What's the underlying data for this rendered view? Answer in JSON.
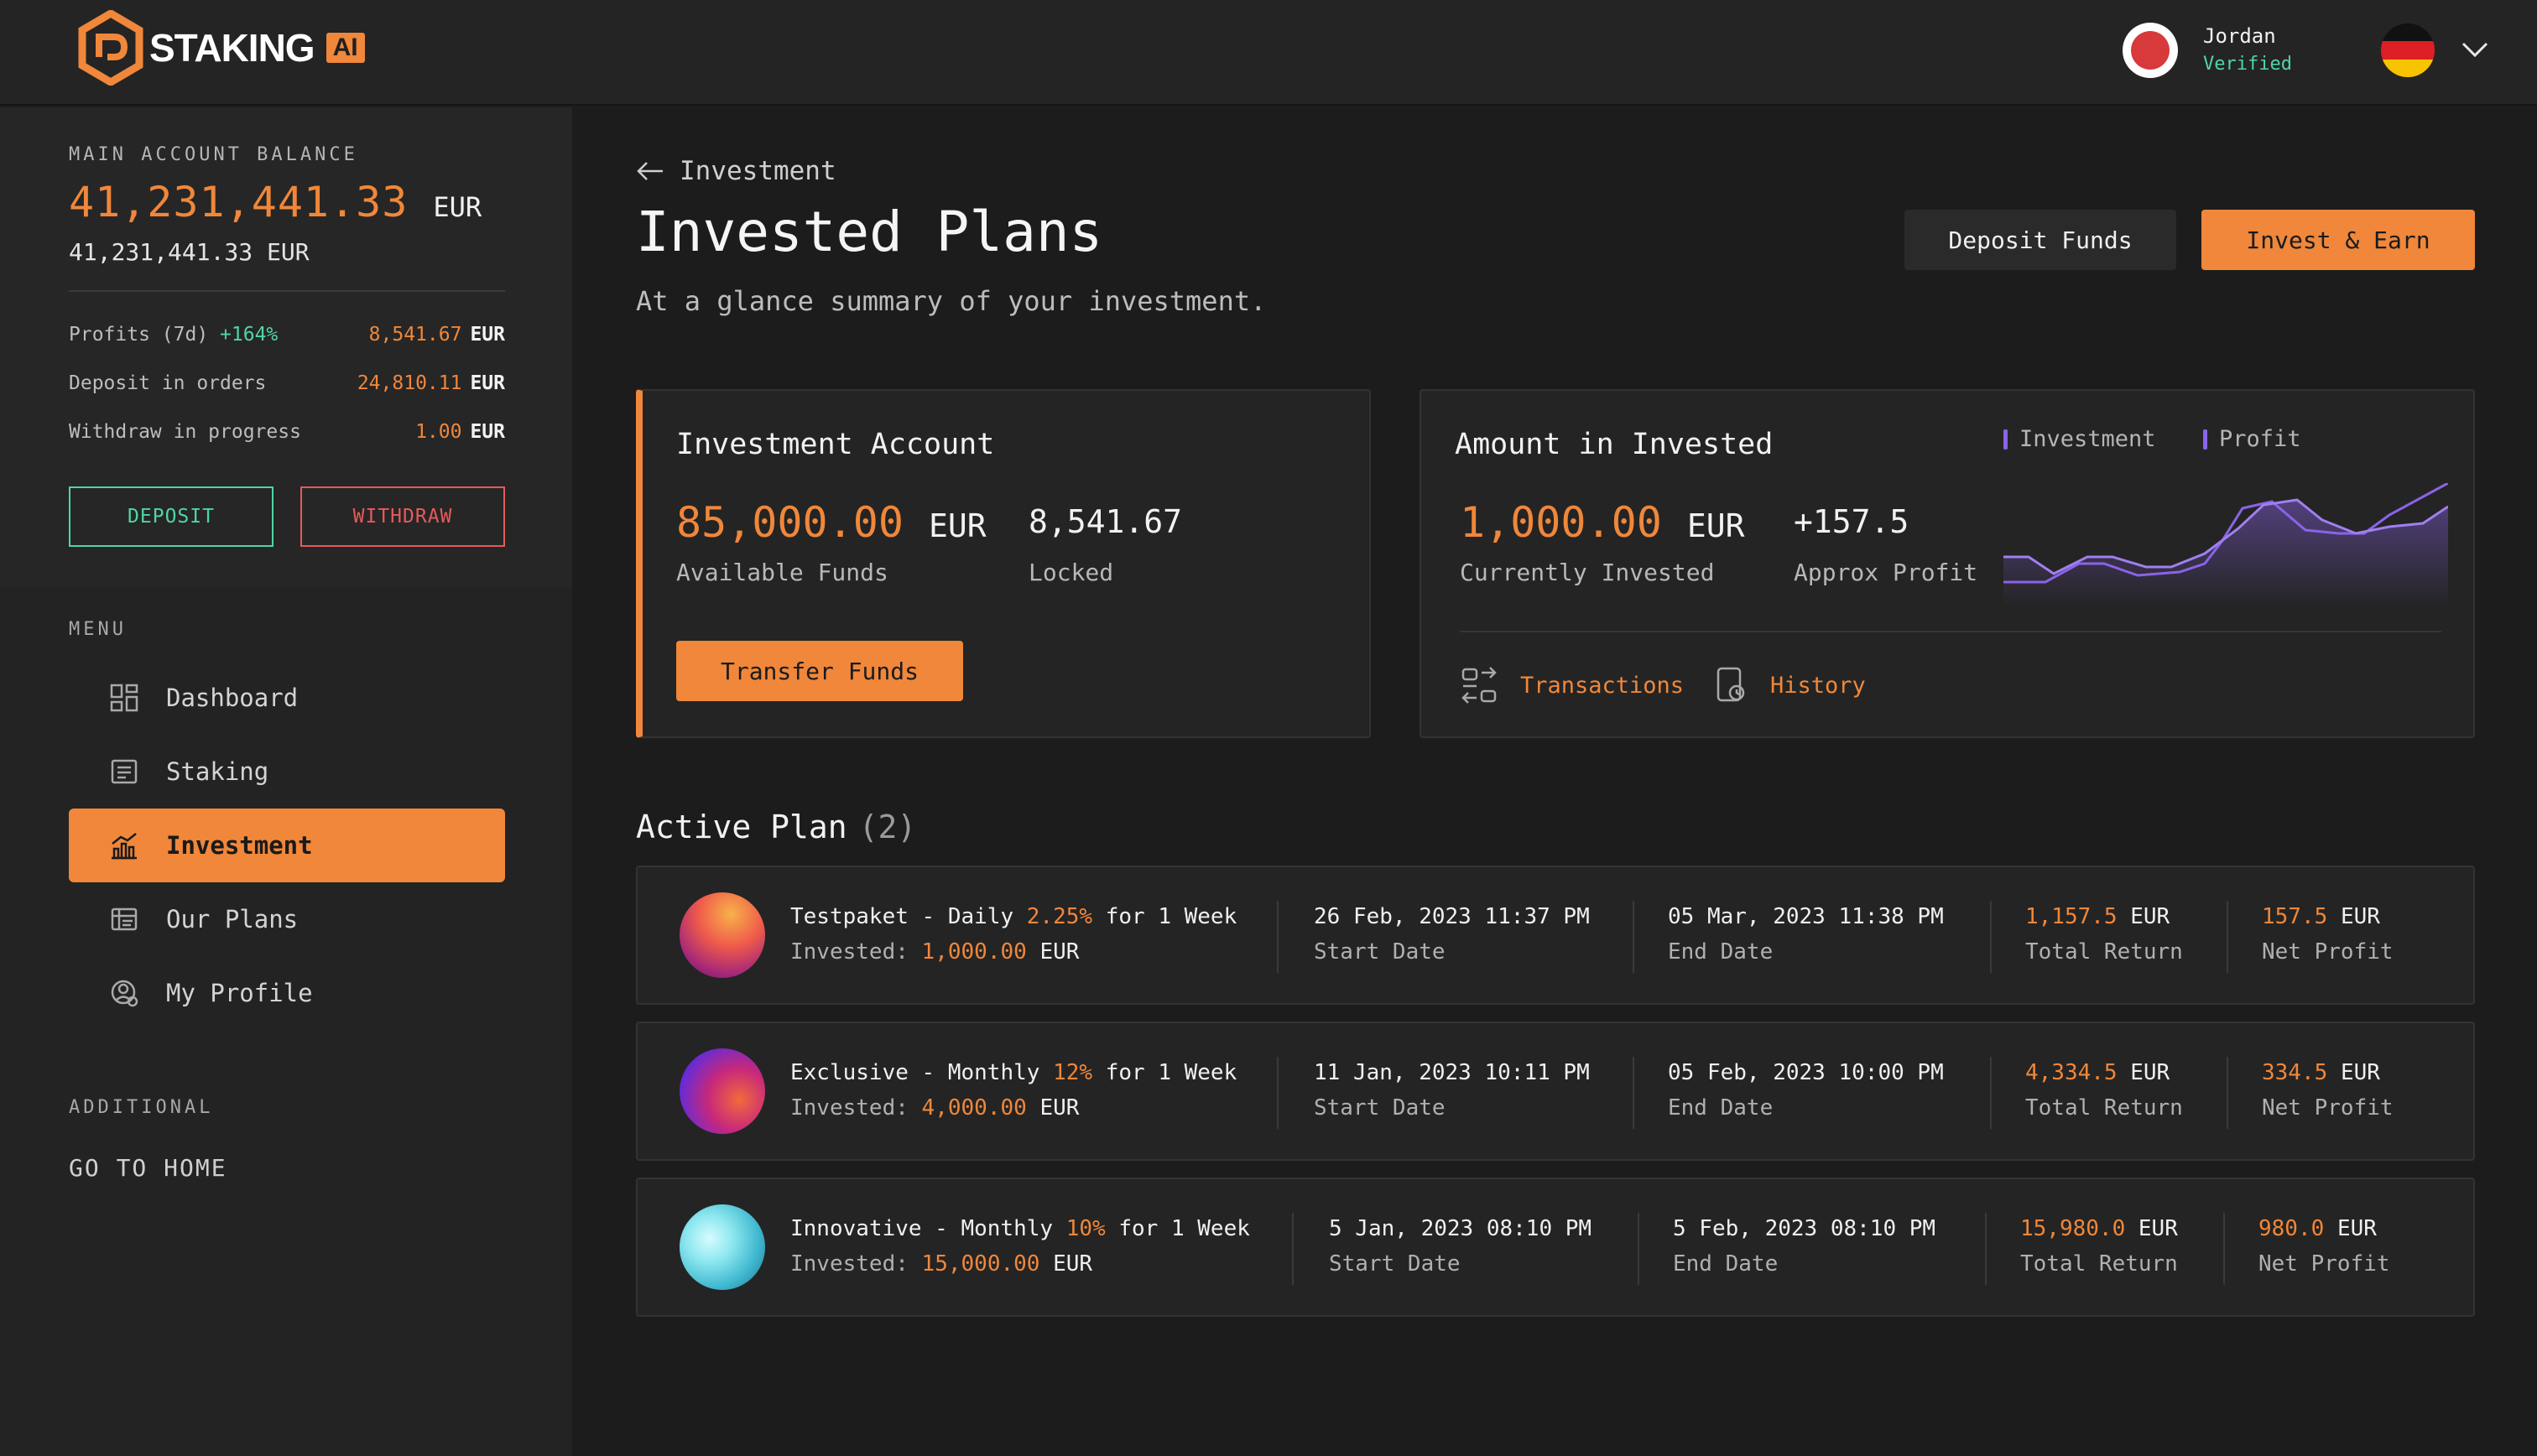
{
  "brand": {
    "name": "STAKING",
    "badge": "AI"
  },
  "user": {
    "name": "Jordan",
    "status": "Verified"
  },
  "colors": {
    "accent": "#f0873a",
    "positive": "#4fd6a2",
    "negative": "#e65a5a",
    "chart_line": "#8b63e8"
  },
  "sidebar": {
    "balance_label": "MAIN ACCOUNT BALANCE",
    "balance_value": "41,231,441.33",
    "balance_currency": "EUR",
    "balance_secondary": "41,231,441.33 EUR",
    "stats": [
      {
        "label": "Profits (7d)",
        "extra": "+164%",
        "value": "8,541.67",
        "currency": "EUR"
      },
      {
        "label": "Deposit in orders",
        "extra": "",
        "value": "24,810.11",
        "currency": "EUR"
      },
      {
        "label": "Withdraw in progress",
        "extra": "",
        "value": "1.00",
        "currency": "EUR"
      }
    ],
    "deposit_label": "DEPOSIT",
    "withdraw_label": "WITHDRAW",
    "menu_label": "MENU",
    "menu": [
      {
        "label": "Dashboard",
        "icon": "dashboard-icon",
        "active": false
      },
      {
        "label": "Staking",
        "icon": "staking-icon",
        "active": false
      },
      {
        "label": "Investment",
        "icon": "investment-icon",
        "active": true
      },
      {
        "label": "Our Plans",
        "icon": "plans-icon",
        "active": false
      },
      {
        "label": "My Profile",
        "icon": "profile-icon",
        "active": false
      }
    ],
    "additional_label": "ADDITIONAL",
    "go_home_label": "GO TO HOME"
  },
  "main": {
    "breadcrumb": "Investment",
    "title": "Invested Plans",
    "subtitle": "At a glance summary of your investment.",
    "deposit_funds_label": "Deposit Funds",
    "invest_earn_label": "Invest & Earn",
    "investment_account": {
      "title": "Investment Account",
      "available_value": "85,000.00",
      "available_currency": "EUR",
      "available_label": "Available Funds",
      "locked_value": "8,541.67",
      "locked_label": "Locked",
      "transfer_label": "Transfer Funds"
    },
    "amount_invested": {
      "title": "Amount in Invested",
      "invested_value": "1,000.00",
      "invested_currency": "EUR",
      "invested_label": "Currently Invested",
      "profit_value": "+157.5",
      "profit_label": "Approx Profit",
      "legend": [
        "Investment",
        "Profit"
      ],
      "transactions_label": "Transactions",
      "history_label": "History"
    },
    "active_plan_title": "Active Plan",
    "active_plan_count": "(2)",
    "plans": [
      {
        "name": "Testpaket - Daily",
        "rate": "2.25%",
        "term": "for 1 Week",
        "invested_label": "Invested:",
        "invested": "1,000.00",
        "currency": "EUR",
        "start": "26 Feb, 2023 11:37 PM",
        "start_label": "Start Date",
        "end": "05 Mar, 2023 11:38 PM",
        "end_label": "End Date",
        "total_return": "1,157.5",
        "total_return_label": "Total Return",
        "net_profit": "157.5",
        "net_profit_label": "Net Profit"
      },
      {
        "name": "Exclusive - Monthly",
        "rate": "12%",
        "term": "for 1 Week",
        "invested_label": "Invested:",
        "invested": "4,000.00",
        "currency": "EUR",
        "start": "11 Jan, 2023 10:11 PM",
        "start_label": "Start Date",
        "end": "05 Feb, 2023 10:00 PM",
        "end_label": "End Date",
        "total_return": "4,334.5",
        "total_return_label": "Total Return",
        "net_profit": "334.5",
        "net_profit_label": "Net Profit"
      },
      {
        "name": "Innovative - Monthly",
        "rate": "10%",
        "term": "for 1 Week",
        "invested_label": "Invested:",
        "invested": "15,000.00",
        "currency": "EUR",
        "start": "5 Jan, 2023 08:10 PM",
        "start_label": "Start Date",
        "end": "5 Feb, 2023 08:10 PM",
        "end_label": "End Date",
        "total_return": "15,980.0",
        "total_return_label": "Total Return",
        "net_profit": "980.0",
        "net_profit_label": "Net Profit"
      }
    ]
  }
}
